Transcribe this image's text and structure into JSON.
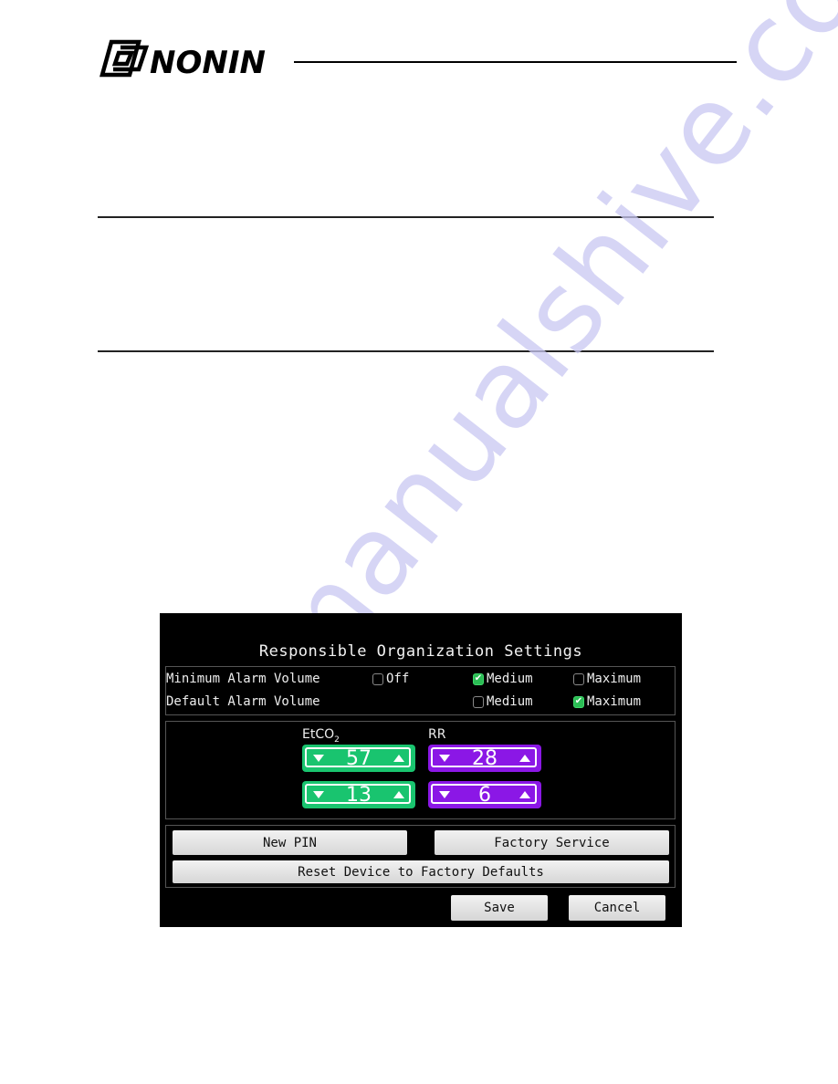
{
  "document": {
    "brand": "NONIN",
    "watermark": "manualshive.com"
  },
  "screen": {
    "title": "Responsible Organization Settings",
    "alarm_volume": {
      "rows": [
        {
          "label": "Minimum Alarm Volume",
          "options": [
            {
              "label": "Off",
              "checked": false
            },
            {
              "label": "Medium",
              "checked": true
            },
            {
              "label": "Maximum",
              "checked": false
            }
          ]
        },
        {
          "label": "Default Alarm Volume",
          "options": [
            {
              "label": "Medium",
              "checked": false
            },
            {
              "label": "Maximum",
              "checked": true
            }
          ]
        }
      ]
    },
    "limits": {
      "etco2": {
        "label": "EtCO",
        "subscript": "2",
        "high": "57",
        "low": "13",
        "color": "#19c46f"
      },
      "rr": {
        "label": "RR",
        "high": "28",
        "low": "6",
        "color": "#8b17e6"
      }
    },
    "buttons": {
      "new_pin": "New PIN",
      "factory_service": "Factory Service",
      "reset_defaults": "Reset Device to Factory Defaults",
      "save": "Save",
      "cancel": "Cancel"
    },
    "check_glyph": "✔"
  }
}
